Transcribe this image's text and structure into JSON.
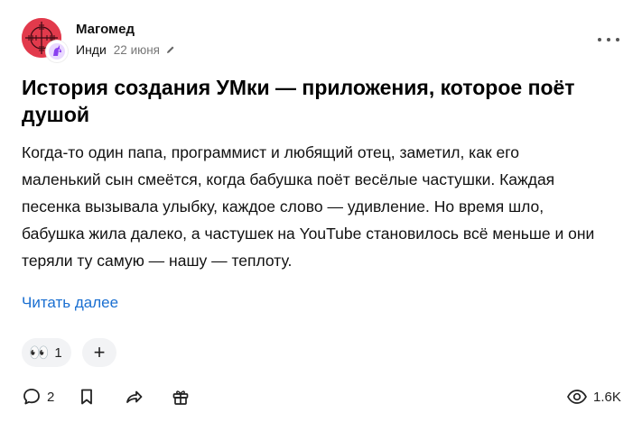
{
  "post": {
    "author": "Магомед",
    "blog_type": "Инди",
    "date": "22 июня",
    "title": "История создания УМки — приложения, которое поёт душой",
    "body": "Когда-то один папа, программист и любящий отец, заметил, как его маленький сын смеётся, когда бабушка поёт весёлые частушки. Каждая песенка вызывала улыбку, каждое слово — удивление. Но время шло, бабушка жила далеко, а частушек на YouTube становилось всё меньше и они теряли ту самую — нашу — теплоту.",
    "read_more": "Читать далее"
  },
  "reactions": {
    "items": [
      {
        "emoji": "👀",
        "count": "1"
      }
    ],
    "add_label": "+"
  },
  "actions": {
    "comments_count": "2",
    "views_count": "1.6K"
  },
  "icons": {
    "avatar": "crosshair-avatar-icon",
    "badge": "unicorn-icon",
    "edited": "pencil-icon",
    "more": "more-dots-icon",
    "comment": "comment-bubble-icon",
    "bookmark": "bookmark-icon",
    "share": "share-arrow-icon",
    "gift": "gift-icon",
    "views": "eye-icon"
  },
  "colors": {
    "avatar_bg": "#e23a4c",
    "link": "#1a6fd1",
    "chip_bg": "#f2f3f5"
  }
}
